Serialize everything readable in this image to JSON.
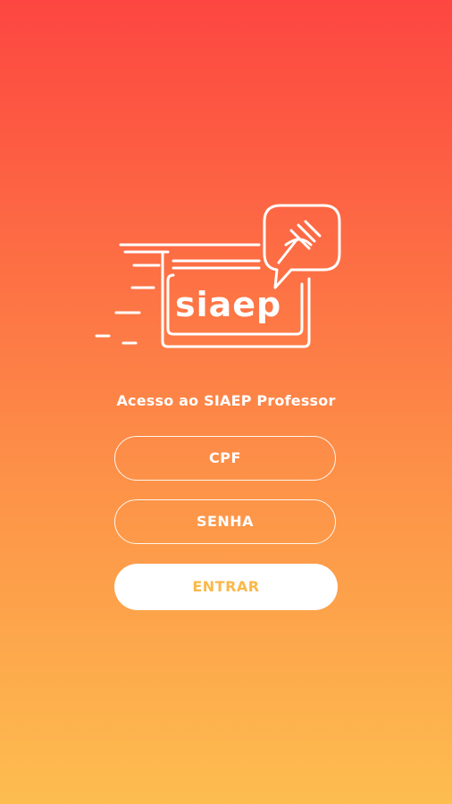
{
  "app": {
    "logo_text": "siaep",
    "subtitle": "Acesso ao SIAEP Professor"
  },
  "form": {
    "cpf_placeholder": "CPF",
    "senha_placeholder": "SENHA",
    "enter_label": "ENTRAR"
  },
  "colors": {
    "gradient_top": "#FD4641",
    "gradient_bottom": "#FDBD4F",
    "button_text": "#FBB848"
  },
  "icons": {
    "logo_mark": "siaep-fork-speech-bubble-logo"
  }
}
